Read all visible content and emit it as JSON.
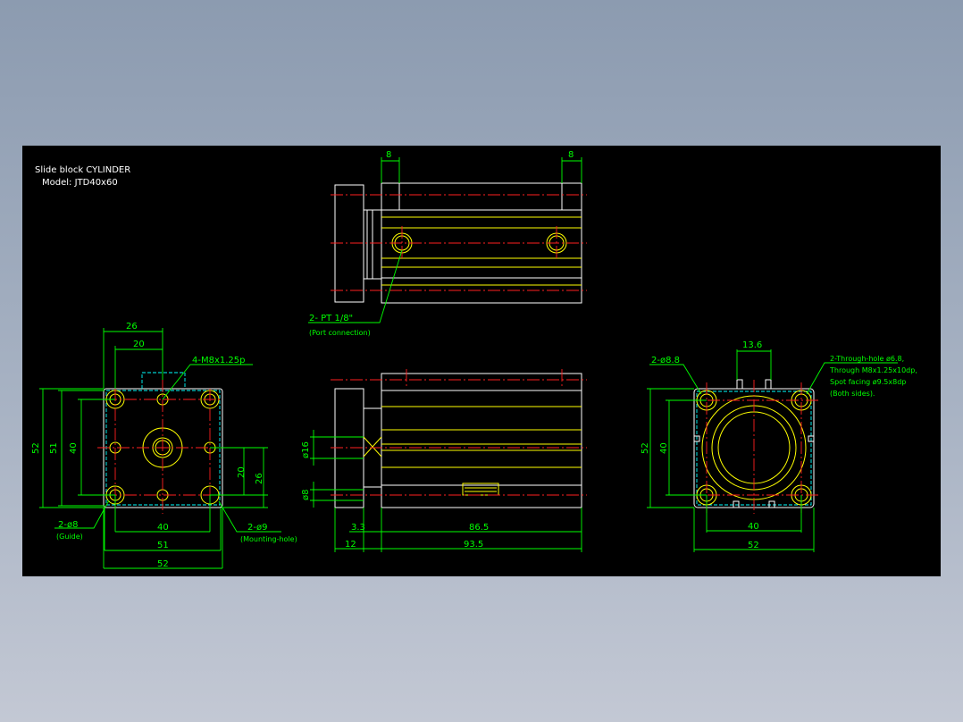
{
  "title": {
    "line1": "Slide block  CYLINDER",
    "line2": "Model:  JTD40x60"
  },
  "left_view": {
    "dim_26": "26",
    "dim_20_top": "20",
    "dim_52_left": "52",
    "dim_51_left": "51",
    "dim_40_left": "40",
    "dim_20_right": "20",
    "dim_26_right": "26",
    "dim_40_bottom": "40",
    "dim_51_bottom": "51",
    "dim_52_bottom": "52",
    "callout_thread": "4-M8x1.25p",
    "callout_guide": "2-ø8",
    "callout_guide_sub": "(Guide)",
    "callout_mount": "2-ø9",
    "callout_mount_sub": "(Mounting-hole)"
  },
  "top_view": {
    "dim_8_left": "8",
    "dim_8_right": "8",
    "callout_port": "2- PT 1/8\"",
    "callout_port_sub": "(Port connection)"
  },
  "front_view": {
    "dim_phi16": "ø16",
    "dim_phi8": "ø8",
    "dim_3_3": "3.3",
    "dim_86_5": "86.5",
    "dim_12": "12",
    "dim_93_5": "93.5"
  },
  "right_view": {
    "dim_13_6": "13.6",
    "callout_phi8_8": "2-ø8.8",
    "callout_through_1": "2-Through-hole ø6.8,",
    "callout_through_2": "Through M8x1.25x10dp,",
    "callout_through_3": "Spot facing ø9.5x8dp",
    "callout_through_4": "(Both sides).",
    "dim_52_left": "52",
    "dim_40_left": "40",
    "dim_40_bottom": "40",
    "dim_52_bottom": "52"
  },
  "colors": {
    "background_outer": "#8c9bb0",
    "viewport": "#000000",
    "outline": "#ffffff",
    "part_lines": "#ffff00",
    "dimensions": "#00ff00",
    "centerlines": "#ff2020",
    "hidden_lines": "#00ffff"
  }
}
